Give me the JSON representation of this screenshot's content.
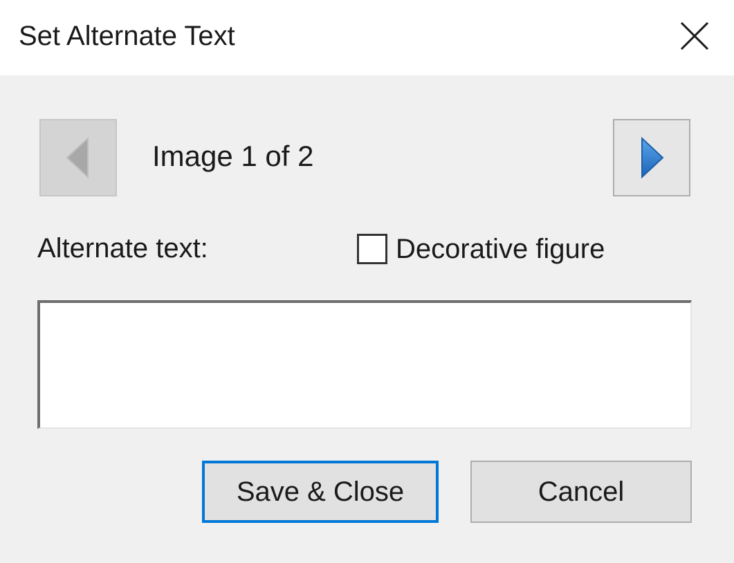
{
  "dialog": {
    "title": "Set Alternate Text"
  },
  "navigation": {
    "counter_text": "Image 1 of 2",
    "prev_icon": "triangle-left-icon",
    "next_icon": "triangle-right-icon"
  },
  "form": {
    "alt_text_label": "Alternate text:",
    "alt_text_value": "",
    "decorative_label": "Decorative figure",
    "decorative_checked": false
  },
  "buttons": {
    "save_label": "Save & Close",
    "cancel_label": "Cancel"
  },
  "colors": {
    "accent": "#0078d7",
    "next_arrow": "#2f7fd6",
    "prev_arrow_disabled": "#a8a8a8"
  }
}
